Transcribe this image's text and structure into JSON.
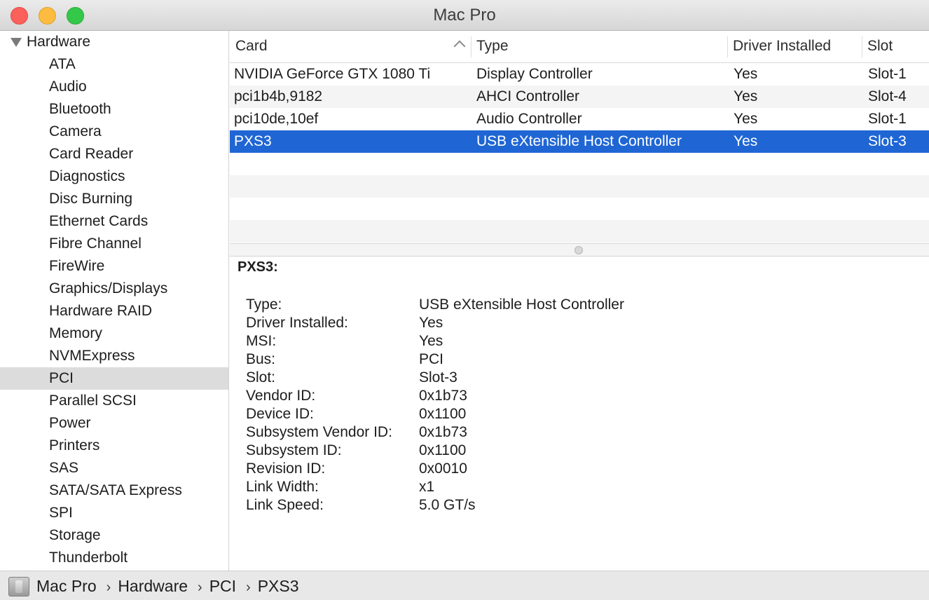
{
  "window": {
    "title": "Mac Pro"
  },
  "sidebar": {
    "header": "Hardware",
    "items": [
      "ATA",
      "Audio",
      "Bluetooth",
      "Camera",
      "Card Reader",
      "Diagnostics",
      "Disc Burning",
      "Ethernet Cards",
      "Fibre Channel",
      "FireWire",
      "Graphics/Displays",
      "Hardware RAID",
      "Memory",
      "NVMExpress",
      "PCI",
      "Parallel SCSI",
      "Power",
      "Printers",
      "SAS",
      "SATA/SATA Express",
      "SPI",
      "Storage",
      "Thunderbolt"
    ],
    "selected": "PCI"
  },
  "table": {
    "columns": [
      "Card",
      "Type",
      "Driver Installed",
      "Slot"
    ],
    "rows": [
      {
        "card": "NVIDIA GeForce GTX 1080 Ti",
        "type": "Display Controller",
        "driver": "Yes",
        "slot": "Slot-1"
      },
      {
        "card": "pci1b4b,9182",
        "type": "AHCI Controller",
        "driver": "Yes",
        "slot": "Slot-4"
      },
      {
        "card": "pci10de,10ef",
        "type": "Audio Controller",
        "driver": "Yes",
        "slot": "Slot-1"
      },
      {
        "card": "PXS3",
        "type": "USB eXtensible Host Controller",
        "driver": "Yes",
        "slot": "Slot-3"
      }
    ],
    "selected_card": "PXS3"
  },
  "detail": {
    "title": "PXS3:",
    "properties": [
      {
        "key": "Type:",
        "value": "USB eXtensible Host Controller"
      },
      {
        "key": "Driver Installed:",
        "value": "Yes"
      },
      {
        "key": "MSI:",
        "value": "Yes"
      },
      {
        "key": "Bus:",
        "value": "PCI"
      },
      {
        "key": "Slot:",
        "value": "Slot-3"
      },
      {
        "key": "Vendor ID:",
        "value": "0x1b73"
      },
      {
        "key": "Device ID:",
        "value": "0x1100"
      },
      {
        "key": "Subsystem Vendor ID:",
        "value": "0x1b73"
      },
      {
        "key": "Subsystem ID:",
        "value": "0x1100"
      },
      {
        "key": "Revision ID:",
        "value": "0x0010"
      },
      {
        "key": "Link Width:",
        "value": "x1"
      },
      {
        "key": "Link Speed:",
        "value": "5.0 GT/s"
      }
    ]
  },
  "pathbar": {
    "icon": "mac-pro-icon",
    "crumbs": [
      "Mac Pro",
      "Hardware",
      "PCI",
      "PXS3"
    ],
    "separator": "›"
  },
  "colors": {
    "selection": "#1f66d4",
    "sidebar_selection": "#dcdcdc",
    "close": "#fc605b",
    "minimize": "#fdbc40",
    "zoom": "#34c84a"
  }
}
